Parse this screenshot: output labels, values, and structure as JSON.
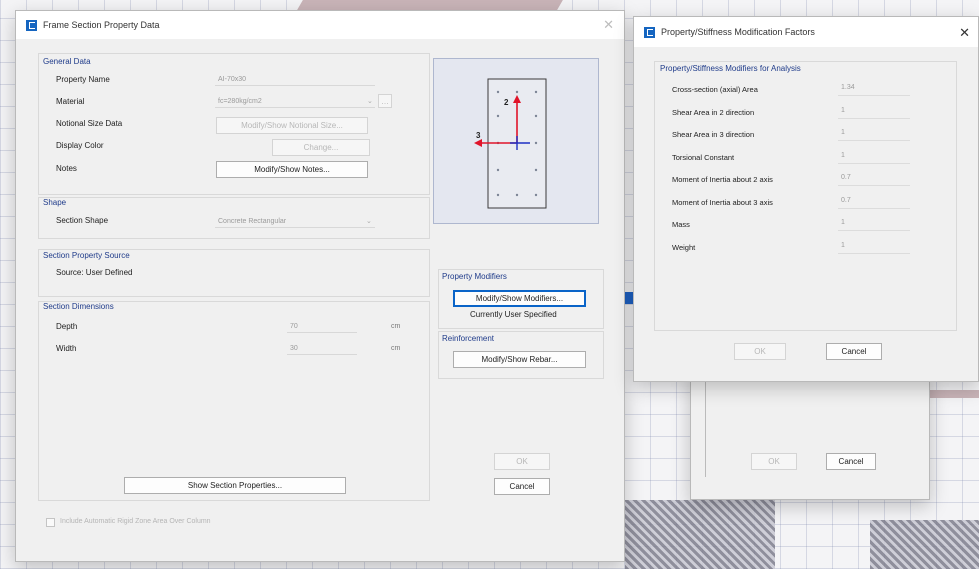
{
  "main_dialog": {
    "title": "Frame Section Property Data",
    "general": {
      "heading": "General Data",
      "property_name_label": "Property Name",
      "property_name_value": "AI-70x30",
      "material_label": "Material",
      "material_value": "fc=280kg/cm2",
      "notional_label": "Notional Size Data",
      "notional_button": "Modify/Show Notional Size...",
      "display_color_label": "Display Color",
      "display_color_button": "Change...",
      "notes_label": "Notes",
      "notes_button": "Modify/Show Notes..."
    },
    "shape": {
      "heading": "Shape",
      "section_shape_label": "Section Shape",
      "section_shape_value": "Concrete Rectangular"
    },
    "source": {
      "heading": "Section Property Source",
      "source_text": "Source:  User Defined"
    },
    "dimensions": {
      "heading": "Section Dimensions",
      "depth_label": "Depth",
      "depth_value": "70",
      "depth_unit": "cm",
      "width_label": "Width",
      "width_value": "30",
      "width_unit": "cm"
    },
    "preview": {
      "axis_2": "2",
      "axis_3": "3"
    },
    "modifiers": {
      "heading": "Property Modifiers",
      "button": "Modify/Show Modifiers...",
      "status": "Currently User Specified"
    },
    "reinforcement": {
      "heading": "Reinforcement",
      "button": "Modify/Show Rebar..."
    },
    "show_section_button": "Show Section Properties...",
    "ok_button": "OK",
    "cancel_button": "Cancel",
    "checkbox_label": "Include Automatic Rigid Zone Area Over Column"
  },
  "modifier_dialog": {
    "title": "Property/Stiffness Modification Factors",
    "heading": "Property/Stiffness Modifiers for Analysis",
    "rows": [
      {
        "label": "Cross-section (axial) Area",
        "value": "1.34"
      },
      {
        "label": "Shear Area in 2 direction",
        "value": "1"
      },
      {
        "label": "Shear Area in 3 direction",
        "value": "1"
      },
      {
        "label": "Torsional Constant",
        "value": "1"
      },
      {
        "label": "Moment of Inertia about 2 axis",
        "value": "0.7"
      },
      {
        "label": "Moment of Inertia about 3 axis",
        "value": "0.7"
      },
      {
        "label": "Mass",
        "value": "1"
      },
      {
        "label": "Weight",
        "value": "1"
      }
    ],
    "ok_button": "OK",
    "cancel_button": "Cancel"
  },
  "background_dialog": {
    "ok_button": "OK",
    "cancel_button": "Cancel"
  },
  "colors": {
    "accent": "#1565c0",
    "group_heading": "#1f3b8a",
    "axis_red": "#e0142a",
    "axis_blue": "#1d2fc4"
  },
  "icons": [
    "app-icon",
    "close-icon",
    "section-preview"
  ]
}
